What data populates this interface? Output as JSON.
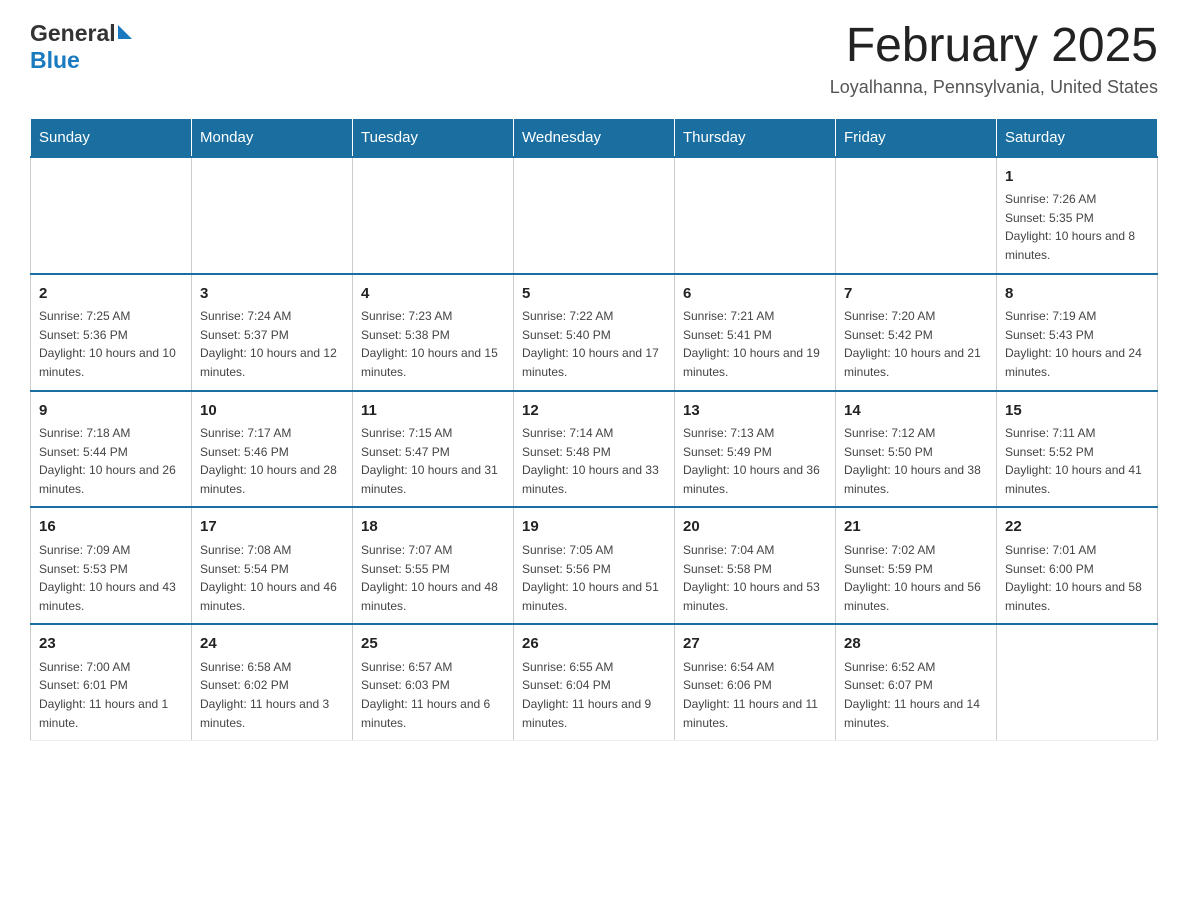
{
  "header": {
    "logo_general": "General",
    "logo_blue": "Blue",
    "month_title": "February 2025",
    "location": "Loyalhanna, Pennsylvania, United States"
  },
  "days_of_week": [
    "Sunday",
    "Monday",
    "Tuesday",
    "Wednesday",
    "Thursday",
    "Friday",
    "Saturday"
  ],
  "weeks": [
    [
      {
        "day": "",
        "info": ""
      },
      {
        "day": "",
        "info": ""
      },
      {
        "day": "",
        "info": ""
      },
      {
        "day": "",
        "info": ""
      },
      {
        "day": "",
        "info": ""
      },
      {
        "day": "",
        "info": ""
      },
      {
        "day": "1",
        "info": "Sunrise: 7:26 AM\nSunset: 5:35 PM\nDaylight: 10 hours and 8 minutes."
      }
    ],
    [
      {
        "day": "2",
        "info": "Sunrise: 7:25 AM\nSunset: 5:36 PM\nDaylight: 10 hours and 10 minutes."
      },
      {
        "day": "3",
        "info": "Sunrise: 7:24 AM\nSunset: 5:37 PM\nDaylight: 10 hours and 12 minutes."
      },
      {
        "day": "4",
        "info": "Sunrise: 7:23 AM\nSunset: 5:38 PM\nDaylight: 10 hours and 15 minutes."
      },
      {
        "day": "5",
        "info": "Sunrise: 7:22 AM\nSunset: 5:40 PM\nDaylight: 10 hours and 17 minutes."
      },
      {
        "day": "6",
        "info": "Sunrise: 7:21 AM\nSunset: 5:41 PM\nDaylight: 10 hours and 19 minutes."
      },
      {
        "day": "7",
        "info": "Sunrise: 7:20 AM\nSunset: 5:42 PM\nDaylight: 10 hours and 21 minutes."
      },
      {
        "day": "8",
        "info": "Sunrise: 7:19 AM\nSunset: 5:43 PM\nDaylight: 10 hours and 24 minutes."
      }
    ],
    [
      {
        "day": "9",
        "info": "Sunrise: 7:18 AM\nSunset: 5:44 PM\nDaylight: 10 hours and 26 minutes."
      },
      {
        "day": "10",
        "info": "Sunrise: 7:17 AM\nSunset: 5:46 PM\nDaylight: 10 hours and 28 minutes."
      },
      {
        "day": "11",
        "info": "Sunrise: 7:15 AM\nSunset: 5:47 PM\nDaylight: 10 hours and 31 minutes."
      },
      {
        "day": "12",
        "info": "Sunrise: 7:14 AM\nSunset: 5:48 PM\nDaylight: 10 hours and 33 minutes."
      },
      {
        "day": "13",
        "info": "Sunrise: 7:13 AM\nSunset: 5:49 PM\nDaylight: 10 hours and 36 minutes."
      },
      {
        "day": "14",
        "info": "Sunrise: 7:12 AM\nSunset: 5:50 PM\nDaylight: 10 hours and 38 minutes."
      },
      {
        "day": "15",
        "info": "Sunrise: 7:11 AM\nSunset: 5:52 PM\nDaylight: 10 hours and 41 minutes."
      }
    ],
    [
      {
        "day": "16",
        "info": "Sunrise: 7:09 AM\nSunset: 5:53 PM\nDaylight: 10 hours and 43 minutes."
      },
      {
        "day": "17",
        "info": "Sunrise: 7:08 AM\nSunset: 5:54 PM\nDaylight: 10 hours and 46 minutes."
      },
      {
        "day": "18",
        "info": "Sunrise: 7:07 AM\nSunset: 5:55 PM\nDaylight: 10 hours and 48 minutes."
      },
      {
        "day": "19",
        "info": "Sunrise: 7:05 AM\nSunset: 5:56 PM\nDaylight: 10 hours and 51 minutes."
      },
      {
        "day": "20",
        "info": "Sunrise: 7:04 AM\nSunset: 5:58 PM\nDaylight: 10 hours and 53 minutes."
      },
      {
        "day": "21",
        "info": "Sunrise: 7:02 AM\nSunset: 5:59 PM\nDaylight: 10 hours and 56 minutes."
      },
      {
        "day": "22",
        "info": "Sunrise: 7:01 AM\nSunset: 6:00 PM\nDaylight: 10 hours and 58 minutes."
      }
    ],
    [
      {
        "day": "23",
        "info": "Sunrise: 7:00 AM\nSunset: 6:01 PM\nDaylight: 11 hours and 1 minute."
      },
      {
        "day": "24",
        "info": "Sunrise: 6:58 AM\nSunset: 6:02 PM\nDaylight: 11 hours and 3 minutes."
      },
      {
        "day": "25",
        "info": "Sunrise: 6:57 AM\nSunset: 6:03 PM\nDaylight: 11 hours and 6 minutes."
      },
      {
        "day": "26",
        "info": "Sunrise: 6:55 AM\nSunset: 6:04 PM\nDaylight: 11 hours and 9 minutes."
      },
      {
        "day": "27",
        "info": "Sunrise: 6:54 AM\nSunset: 6:06 PM\nDaylight: 11 hours and 11 minutes."
      },
      {
        "day": "28",
        "info": "Sunrise: 6:52 AM\nSunset: 6:07 PM\nDaylight: 11 hours and 14 minutes."
      },
      {
        "day": "",
        "info": ""
      }
    ]
  ]
}
